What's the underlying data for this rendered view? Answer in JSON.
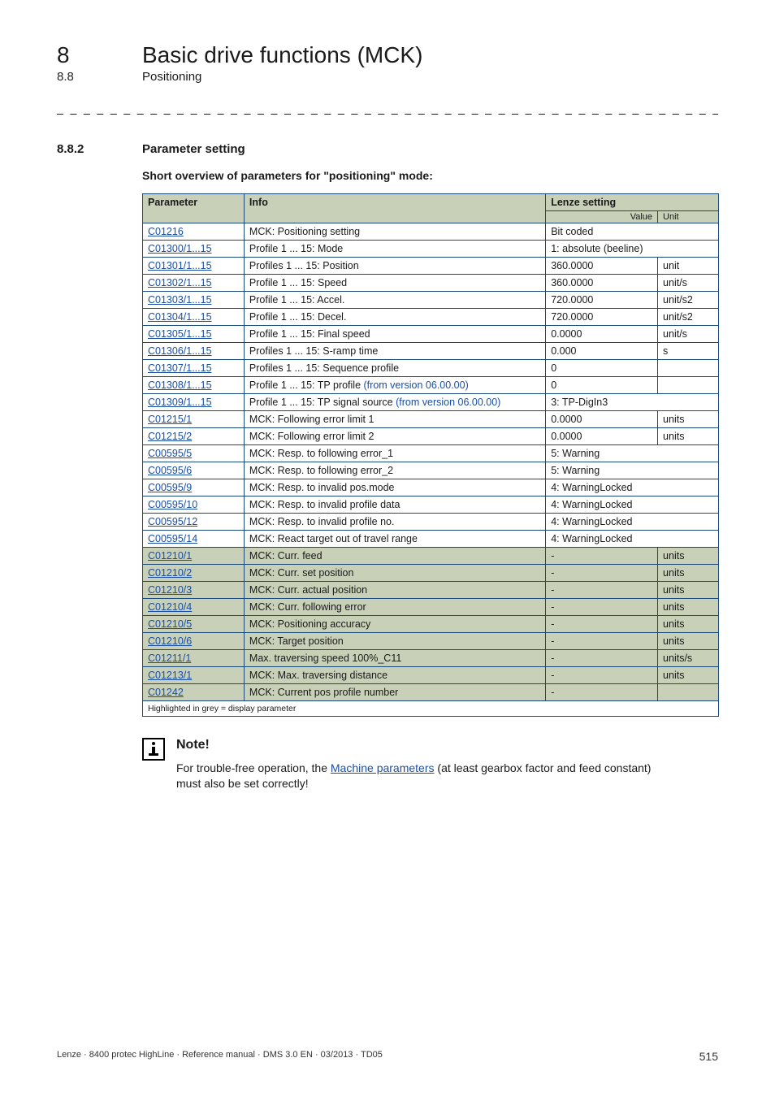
{
  "header": {
    "chapter_num": "8",
    "chapter_title": "Basic drive functions (MCK)",
    "sub_num": "8.8",
    "sub_title": "Positioning"
  },
  "section": {
    "num": "8.8.2",
    "title": "Parameter setting",
    "overview": "Short overview of parameters for \"positioning\" mode:"
  },
  "table": {
    "headers": {
      "param": "Parameter",
      "info": "Info",
      "lenze": "Lenze setting",
      "value": "Value",
      "unit": "Unit"
    },
    "rows": [
      {
        "param": "C01216",
        "info": "MCK: Positioning setting",
        "value": "Bit coded",
        "span": true
      },
      {
        "param": "C01300/1...15",
        "info": "Profile 1 ... 15: Mode",
        "value": "1: absolute (beeline)",
        "span": true
      },
      {
        "param": "C01301/1...15",
        "info": "Profiles 1 ... 15: Position",
        "value": "360.0000",
        "unit": "unit"
      },
      {
        "param": "C01302/1...15",
        "info": "Profile 1 ... 15: Speed",
        "value": "360.0000",
        "unit": "unit/s"
      },
      {
        "param": "C01303/1...15",
        "info": "Profile 1 ... 15: Accel.",
        "value": "720.0000",
        "unit": "unit/s2"
      },
      {
        "param": "C01304/1...15",
        "info": "Profile 1 ... 15: Decel.",
        "value": "720.0000",
        "unit": "unit/s2"
      },
      {
        "param": "C01305/1...15",
        "info": "Profile 1 ... 15: Final speed",
        "value": "0.0000",
        "unit": "unit/s"
      },
      {
        "param": "C01306/1...15",
        "info": "Profiles 1 ... 15: S-ramp time",
        "value": "0.000",
        "unit": "s"
      },
      {
        "param": "C01307/1...15",
        "info": "Profiles 1 ... 15: Sequence profile",
        "value": "0",
        "unit": ""
      },
      {
        "param": "C01308/1...15",
        "info": "Profile 1 ... 15: TP profile ",
        "info_blue": "(from version 06.00.00)",
        "value": "0",
        "unit": ""
      },
      {
        "param": "C01309/1...15",
        "info": "Profile 1 ... 15: TP signal source ",
        "info_blue": "(from version 06.00.00)",
        "value": "3: TP-DigIn3",
        "span": true
      },
      {
        "param": "C01215/1",
        "info": "MCK: Following error limit 1",
        "value": "0.0000",
        "unit": "units"
      },
      {
        "param": "C01215/2",
        "info": "MCK: Following error limit 2",
        "value": "0.0000",
        "unit": "units"
      },
      {
        "param": "C00595/5",
        "info": "MCK: Resp. to following error_1",
        "value": "5: Warning",
        "span": true
      },
      {
        "param": "C00595/6",
        "info": "MCK: Resp. to following error_2",
        "value": "5: Warning",
        "span": true
      },
      {
        "param": "C00595/9",
        "info": "MCK: Resp. to invalid pos.mode",
        "value": "4: WarningLocked",
        "span": true
      },
      {
        "param": "C00595/10",
        "info": "MCK: Resp. to invalid profile data",
        "value": "4: WarningLocked",
        "span": true
      },
      {
        "param": "C00595/12",
        "info": "MCK: Resp. to invalid profile no.",
        "value": "4: WarningLocked",
        "span": true
      },
      {
        "param": "C00595/14",
        "info": "MCK: React target out of travel range",
        "value": "4: WarningLocked",
        "span": true
      },
      {
        "param": "C01210/1",
        "info": "MCK: Curr. feed",
        "value": "-",
        "unit": "units",
        "grey": true
      },
      {
        "param": "C01210/2",
        "info": "MCK: Curr. set position",
        "value": "-",
        "unit": "units",
        "grey": true
      },
      {
        "param": "C01210/3",
        "info": "MCK: Curr. actual position",
        "value": "-",
        "unit": "units",
        "grey": true
      },
      {
        "param": "C01210/4",
        "info": "MCK: Curr. following error",
        "value": "-",
        "unit": "units",
        "grey": true
      },
      {
        "param": "C01210/5",
        "info": "MCK: Positioning accuracy",
        "value": "-",
        "unit": "units",
        "grey": true
      },
      {
        "param": "C01210/6",
        "info": "MCK: Target position",
        "value": "-",
        "unit": "units",
        "grey": true
      },
      {
        "param": "C01211/1",
        "info": "Max. traversing speed 100%_C11",
        "value": "-",
        "unit": "units/s",
        "grey": true
      },
      {
        "param": "C01213/1",
        "info": "MCK: Max. traversing distance",
        "value": "-",
        "unit": "units",
        "grey": true
      },
      {
        "param": "C01242",
        "info": "MCK: Current pos profile number",
        "value": "-",
        "unit": "",
        "grey": true
      }
    ],
    "footnote": "Highlighted in grey = display parameter"
  },
  "note": {
    "title": "Note!",
    "text_pre": "For trouble-free operation, the ",
    "link": "Machine parameters",
    "text_post": " (at least gearbox factor and feed constant) must also be set correctly!"
  },
  "footer": {
    "left": "Lenze · 8400 protec HighLine · Reference manual · DMS 3.0 EN · 03/2013 · TD05",
    "right": "515"
  }
}
